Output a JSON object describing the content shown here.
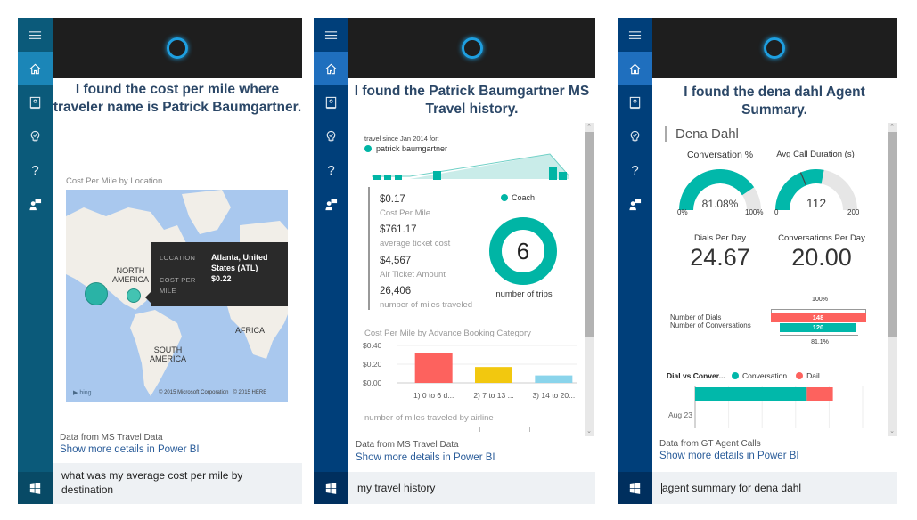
{
  "panels": [
    {
      "sidebar": {
        "items": [
          {
            "icon": "hamburger-menu-icon"
          },
          {
            "icon": "home-icon",
            "active": true
          },
          {
            "icon": "notebook-icon"
          },
          {
            "icon": "lightbulb-icon"
          },
          {
            "icon": "help-icon",
            "glyph": "?"
          },
          {
            "icon": "feedback-icon"
          }
        ],
        "start_icon": "windows-start-icon",
        "color": "#0b5a7a"
      },
      "title": "I found the cost per mile where traveler name is Patrick Baumgartner.",
      "title_lines": [
        "I found the cost per mile where",
        "traveler name is Patrick Baumgartner."
      ],
      "map": {
        "label": "Cost Per Mile by Location",
        "regions": [
          "NORTH AMERICA",
          "SOUTH AMERICA",
          "AFRICA"
        ],
        "north_america": [
          "NORTH",
          "AMERICA"
        ],
        "south_america": [
          "SOUTH",
          "AMERICA"
        ],
        "africa": "AFRICA",
        "attribution_bing": "bing",
        "copyright": "© 2015 Microsoft Corporation   © 2015 HERE",
        "tooltip": {
          "location_key": "LOCATION",
          "location_value_1": "Atlanta, United",
          "location_value_2": "States (ATL)",
          "cost_key_1": "COST PER",
          "cost_key_2": "MILE",
          "cost_value": "$0.22"
        },
        "bubble_color": "#20b2a0"
      },
      "source": "Data from MS Travel Data",
      "link": "Show more details in Power BI",
      "query_lines": [
        "what was my average cost per mile by",
        "destination"
      ]
    },
    {
      "sidebar": {
        "items": [
          {
            "icon": "hamburger-menu-icon"
          },
          {
            "icon": "home-icon",
            "active": true
          },
          {
            "icon": "notebook-icon"
          },
          {
            "icon": "lightbulb-icon"
          },
          {
            "icon": "help-icon",
            "glyph": "?"
          },
          {
            "icon": "feedback-icon"
          }
        ],
        "start_icon": "windows-start-icon",
        "color": "#003f7a"
      },
      "title_lines": [
        "I found the Patrick Baumgartner MS",
        "Travel history."
      ],
      "travel_since": "travel since Jan 2014 for:",
      "legend_person": "patrick baumgartner",
      "kpis": [
        {
          "value": "$0.17",
          "label": "Cost Per Mile"
        },
        {
          "value": "$761.17",
          "label": "average ticket cost"
        },
        {
          "value": "$4,567",
          "label": "Air Ticket Amount"
        },
        {
          "value": "26,406",
          "label": "number of miles traveled"
        }
      ],
      "donut": {
        "legend": "Coach",
        "value": "6",
        "label": "number of trips",
        "color": "#00b5a5"
      },
      "bar_chart": {
        "title": "Cost Per Mile by Advance Booking Category",
        "y_ticks": [
          "$0.40",
          "$0.20",
          "$0.00"
        ],
        "ylim": [
          0,
          0.4
        ],
        "categories": [
          "1) 0 to 6 d...",
          "2) 7 to 13 ...",
          "3) 14 to 20..."
        ],
        "values": [
          0.32,
          0.17,
          0.08
        ],
        "colors": [
          "#fd625e",
          "#f2c80f",
          "#8ad4eb"
        ]
      },
      "next_section": "number of miles traveled by airline",
      "source": "Data from MS Travel Data",
      "link": "Show more details in Power BI",
      "query": "my travel history",
      "scroll_thumb_fraction": 0.65
    },
    {
      "sidebar": {
        "items": [
          {
            "icon": "hamburger-menu-icon"
          },
          {
            "icon": "home-icon",
            "active": true
          },
          {
            "icon": "notebook-icon"
          },
          {
            "icon": "lightbulb-icon"
          },
          {
            "icon": "help-icon",
            "glyph": "?"
          },
          {
            "icon": "feedback-icon"
          }
        ],
        "start_icon": "windows-start-icon",
        "color": "#003f7a"
      },
      "title_lines": [
        "I found the dena dahl Agent",
        "Summary."
      ],
      "agent_name": "Dena Dahl",
      "gauges": [
        {
          "title": "Conversation %",
          "value_text": "81.08%",
          "value": 81.08,
          "min": 0,
          "max": 100,
          "min_label": "0%",
          "max_label": "100%"
        },
        {
          "title": "Avg Call Duration (s)",
          "value_text": "112",
          "value": 112,
          "min": 0,
          "max": 200,
          "min_label": "0",
          "max_label": "200",
          "target": 75
        }
      ],
      "cards": [
        {
          "title": "Dials Per Day",
          "value": "24.67"
        },
        {
          "title": "Conversations Per Day",
          "value": "20.00"
        }
      ],
      "funnel": {
        "top_pct": "100%",
        "bottom_pct": "81.1%",
        "rows": [
          {
            "label": "Number of Dials",
            "value": "148",
            "num": 148,
            "color": "#fd625e"
          },
          {
            "label": "Number of Conversations",
            "value": "120",
            "num": 120,
            "color": "#01b8aa"
          }
        ]
      },
      "stacked": {
        "title": "Dial vs Conver...",
        "legend": [
          {
            "name": "Conversation",
            "color": "#01b8aa"
          },
          {
            "name": "Dail",
            "color": "#fd625e"
          }
        ],
        "row_label": "Aug 23",
        "conversation": 20,
        "dial": 4.67
      },
      "source": "Data from GT Agent Calls",
      "link": "Show more details in Power BI",
      "query": "agent summary for dena dahl",
      "scroll_thumb_fraction": 0.65
    }
  ],
  "colors": {
    "teal": "#01b8aa",
    "red": "#fd625e",
    "title": "#2b4767",
    "link": "#2b5d9a",
    "cortana": "#1e9fe0"
  }
}
